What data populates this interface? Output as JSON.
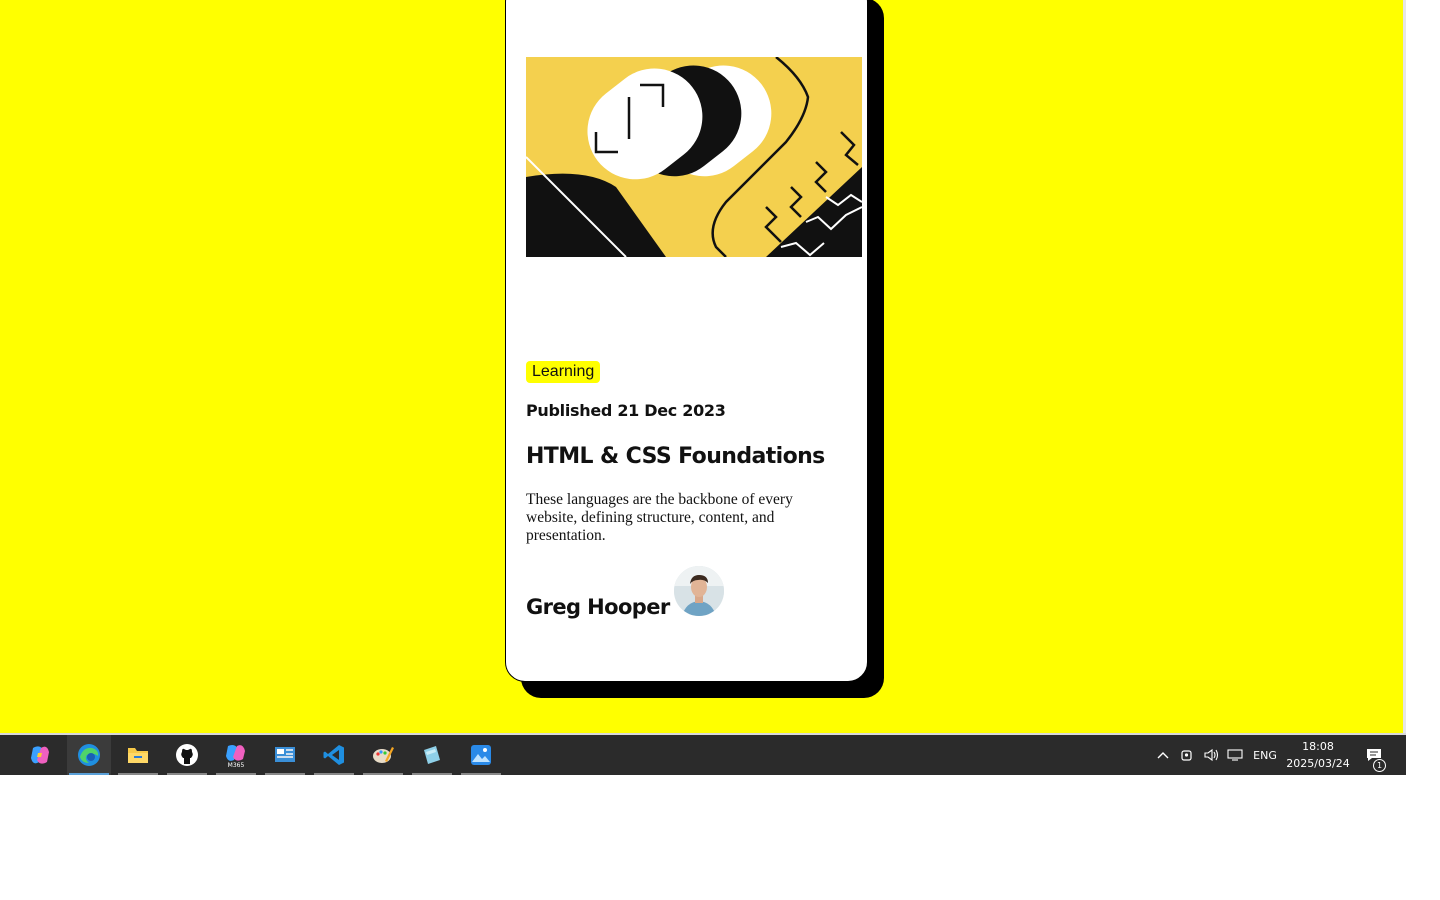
{
  "page": {
    "background": "#ffff00"
  },
  "card": {
    "badge": "Learning",
    "published": "Published 21 Dec 2023",
    "title": "HTML & CSS Foundations",
    "description": "These languages are the backbone of every website, defining structure, content, and presentation.",
    "author": "Greg Hooper",
    "colors": {
      "badge_bg": "#ffff00",
      "hero_bg": "#f4d04e",
      "shadow": "#000000"
    }
  },
  "taskbar": {
    "apps": [
      {
        "icon": "copilot-icon"
      },
      {
        "icon": "edge-browser-icon",
        "active": true
      },
      {
        "icon": "file-explorer-icon"
      },
      {
        "icon": "github-icon"
      },
      {
        "icon": "m365-copilot-icon",
        "label": "M365"
      },
      {
        "icon": "control-panel-icon"
      },
      {
        "icon": "vscode-icon"
      },
      {
        "icon": "paint-icon"
      },
      {
        "icon": "notepad-icon"
      },
      {
        "icon": "photos-icon"
      }
    ],
    "tray": {
      "language": "ENG",
      "time": "18:08",
      "date": "2025/03/24",
      "notification_count": "1"
    }
  }
}
